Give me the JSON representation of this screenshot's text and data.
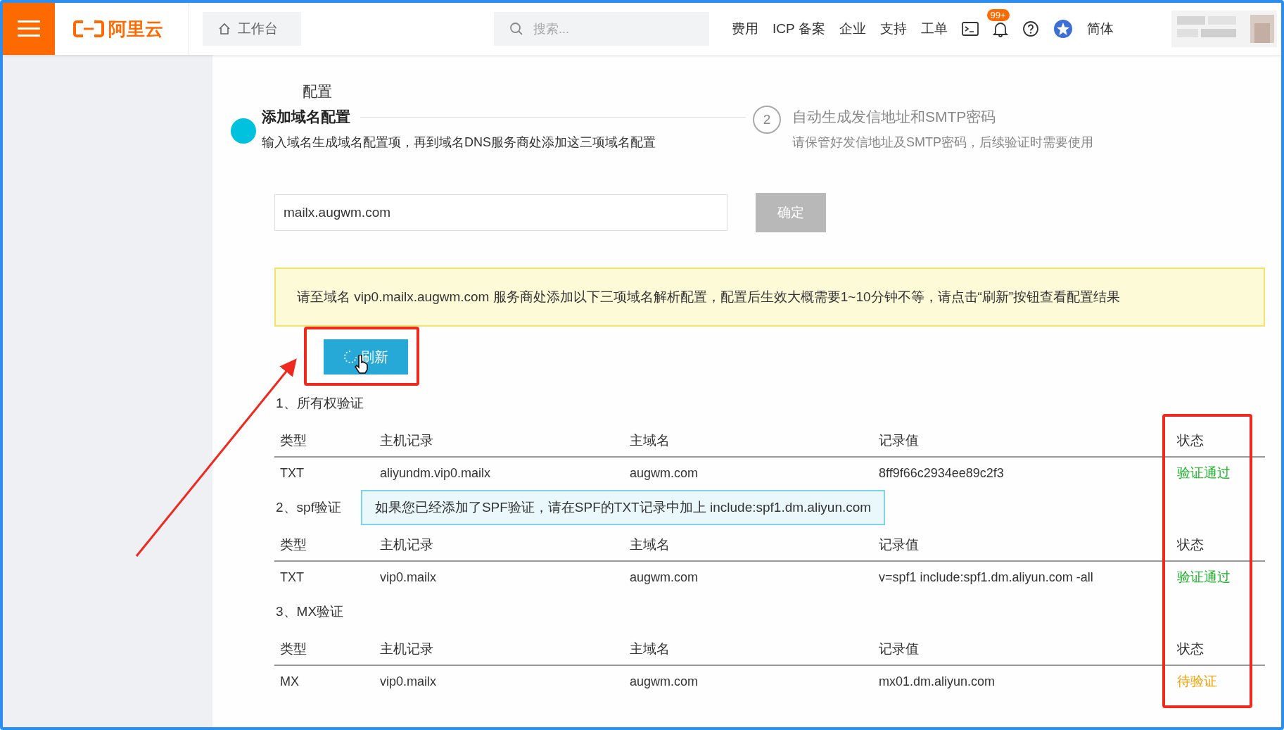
{
  "topbar": {
    "logo": "阿里云",
    "workbench": "工作台",
    "search": {
      "placeholder": "搜索..."
    },
    "nav": [
      "费用",
      "ICP 备案",
      "企业",
      "支持",
      "工单"
    ],
    "notification_badge": "99+",
    "language": "简体"
  },
  "page": {
    "title": "配置",
    "steps": [
      {
        "title": "添加域名配置",
        "description": "输入域名生成域名配置项，再到域名DNS服务商处添加这三项域名配置",
        "selected": true
      },
      {
        "number": "2",
        "title": "自动生成发信地址和SMTP密码",
        "description": "请保管好发信地址及SMTP密码，后续验证时需要使用",
        "selected": false
      }
    ],
    "domain_field": {
      "value": "mailx.augwm.com"
    },
    "confirm_button": {
      "label": "确定",
      "disabled": true
    },
    "alert": "请至域名 vip0.mailx.augwm.com 服务商处添加以下三项域名解析配置，配置后生效大概需要1~10分钟不等，请点击“刷新”按钮查看配置结果",
    "refresh_button": {
      "label": "刷新",
      "loading": true
    },
    "sections": [
      {
        "title": "1、所有权验证",
        "columns": [
          "类型",
          "主机记录",
          "主域名",
          "记录值",
          "状态"
        ],
        "rows": [
          {
            "cells": [
              "TXT",
              "aliyundm.vip0.mailx",
              "augwm.com",
              "8ff9f66c2934ee89c2f3"
            ],
            "status": "验证通过",
            "kind": "verified"
          }
        ]
      },
      {
        "title": "2、spf验证",
        "hint": "如果您已经添加了SPF验证，请在SPF的TXT记录中加上 include:spf1.dm.aliyun.com",
        "columns": [
          "类型",
          "主机记录",
          "主域名",
          "记录值",
          "状态"
        ],
        "rows": [
          {
            "cells": [
              "TXT",
              "vip0.mailx",
              "augwm.com",
              "v=spf1 include:spf1.dm.aliyun.com -all"
            ],
            "status": "验证通过",
            "kind": "verified"
          }
        ]
      },
      {
        "title": "3、MX验证",
        "columns": [
          "类型",
          "主机记录",
          "主域名",
          "记录值",
          "状态"
        ],
        "rows": [
          {
            "cells": [
              "MX",
              "vip0.mailx",
              "augwm.com",
              "mx01.dm.aliyun.com"
            ],
            "status": "待验证",
            "kind": "pending"
          }
        ]
      }
    ]
  }
}
